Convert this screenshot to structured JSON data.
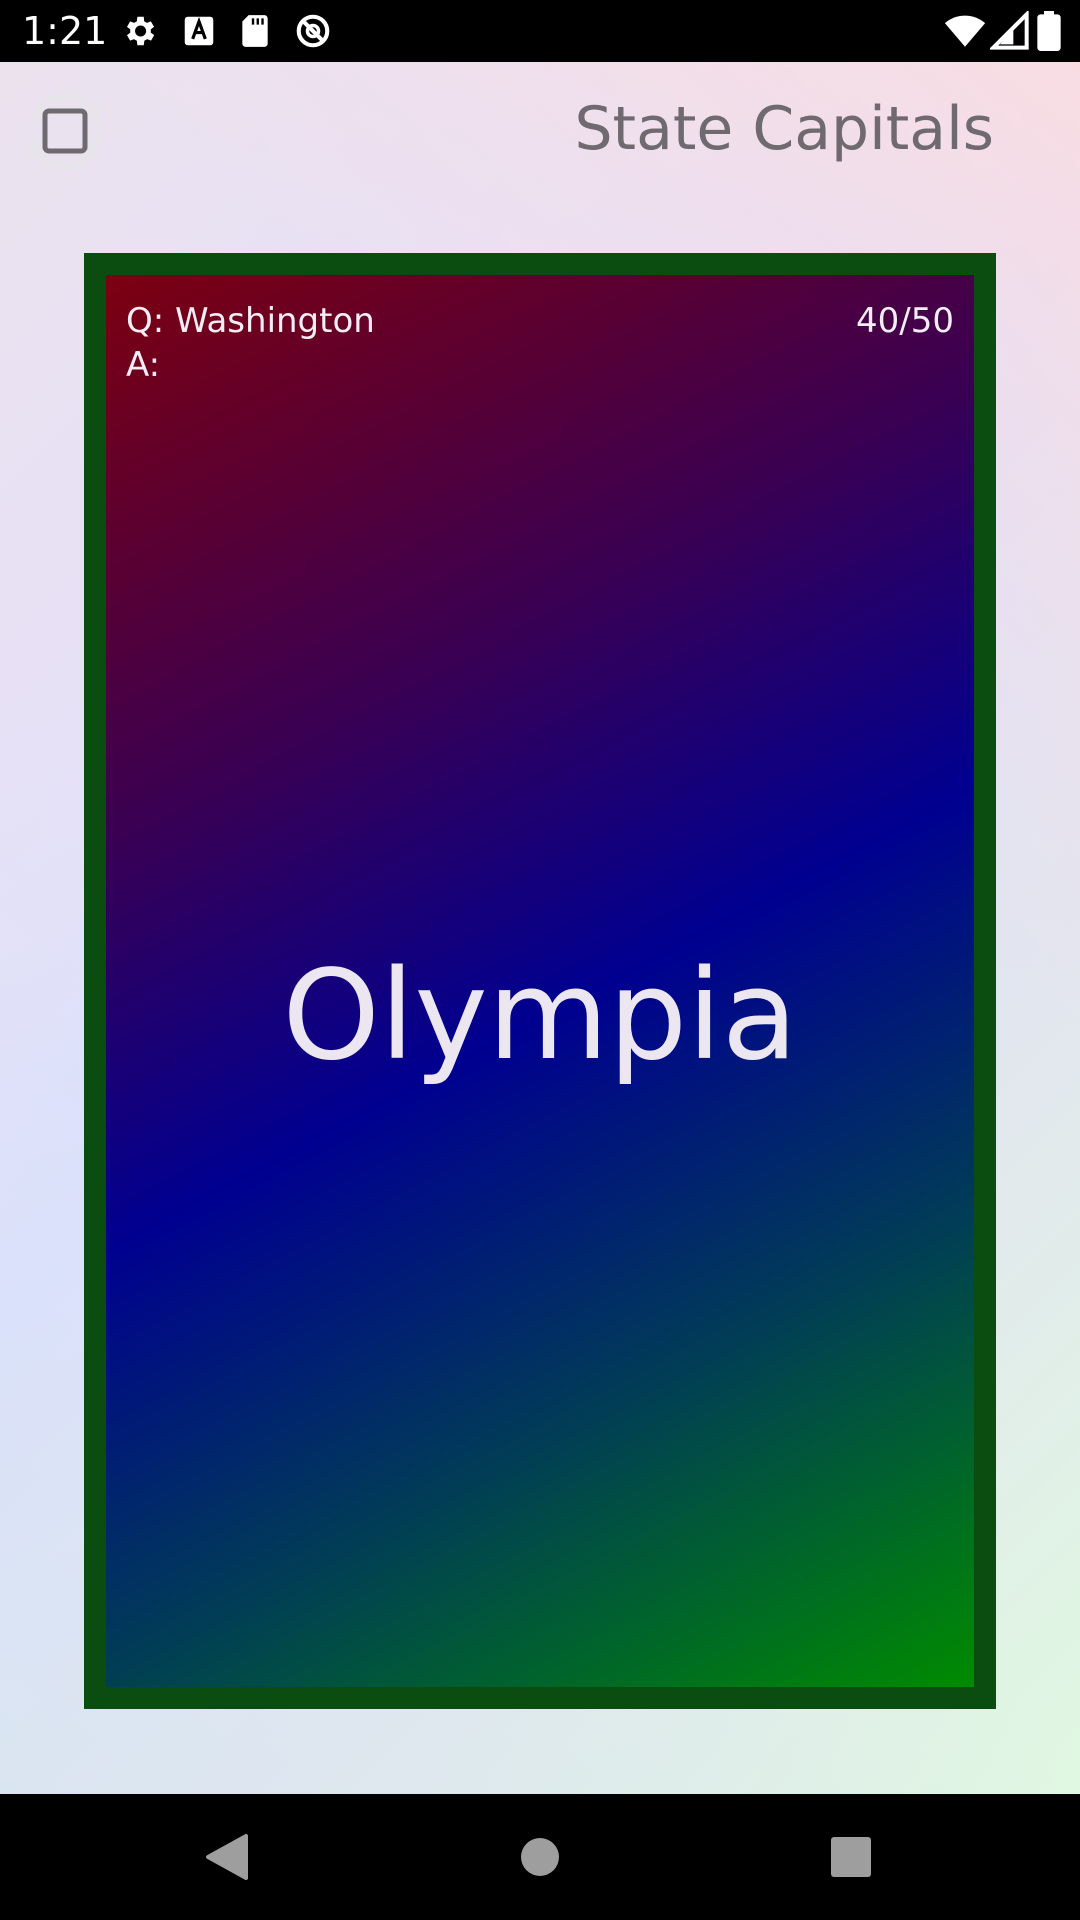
{
  "status_bar": {
    "time": "1:21",
    "left_icons": [
      "gear-icon",
      "font-a-icon",
      "sd-card-icon",
      "no-entry-icon"
    ],
    "right_icons": [
      "wifi-icon",
      "cell-signal-icon",
      "battery-icon"
    ]
  },
  "app": {
    "title": "State Capitals",
    "shuffle_toggle_icon": "checkbox-refresh-icon"
  },
  "card": {
    "question_label": "Q: Washington",
    "answer_label": "A:",
    "counter": "40/50",
    "answer_text": "Olympia"
  },
  "nav_bar": {
    "buttons": [
      "back-triangle-icon",
      "home-circle-icon",
      "recents-square-icon"
    ]
  },
  "colors": {
    "card_border": "#0b4d10",
    "gradient_start": "#7c0010",
    "gradient_mid": "#000090",
    "gradient_end": "#008b00",
    "title_text": "#6f6a6f"
  }
}
